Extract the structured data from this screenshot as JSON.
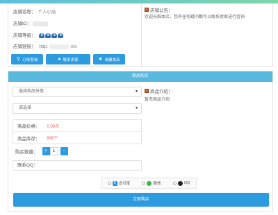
{
  "shop": {
    "name_label": "店铺名称：",
    "name_value": "个人小店",
    "id_label": "店铺ID：",
    "level_label": "店铺等级：",
    "level_icons": [
      "crown-icon",
      "crown-icon",
      "crown-icon",
      "crown-icon"
    ],
    "url_label": "店铺链接：",
    "url_prefix": "http:",
    "url_suffix": "/m/",
    "buttons": {
      "query": "订单查询",
      "contact": "联系卖家",
      "collect": "收藏本店"
    }
  },
  "notice": {
    "title": "店铺公告：",
    "text": "欢迎光临本店，您有任何疑问都可以联系卖家进行咨询"
  },
  "order": {
    "header": "商品购买",
    "category_select": "选择商品分类",
    "product_select": "请选择",
    "price_label": "商品价格：",
    "price_value": "0.00元",
    "stock_label": "商品库存：",
    "stock_value": "999个",
    "qty_label": "购买数量：",
    "qty_minus": "+",
    "qty_value": "1",
    "qty_plus": "-",
    "qq_label": "联系QQ：",
    "goods_title": "商品介绍：",
    "goods_text": "暂无商品介绍"
  },
  "payment": {
    "options": [
      {
        "label": "支付宝",
        "icon": "alipay-icon",
        "color": "#1e88e5"
      },
      {
        "label": "微信",
        "icon": "wechat-icon",
        "color": "#3bb54a"
      },
      {
        "label": "QQ",
        "icon": "qq-icon",
        "color": "#222222"
      }
    ]
  },
  "buy_button": "立即购买"
}
